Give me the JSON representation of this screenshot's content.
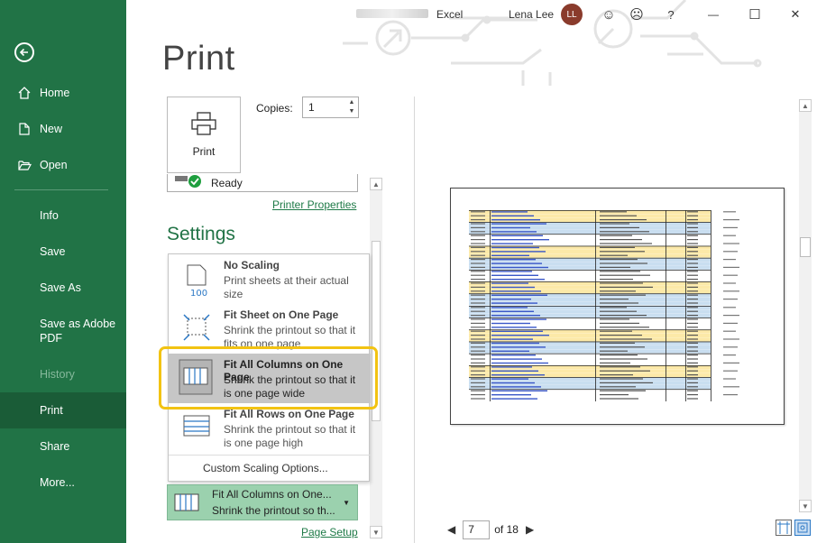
{
  "app": {
    "name": "Excel",
    "user_name": "Lena Lee",
    "user_initials": "LL"
  },
  "window_controls": {
    "smile": "☺",
    "frown": "☹",
    "help": "?",
    "minimize": "—",
    "maximize": "☐",
    "close": "✕"
  },
  "sidebar": {
    "items": [
      {
        "label": "Home",
        "icon": "home-icon"
      },
      {
        "label": "New",
        "icon": "new-file-icon"
      },
      {
        "label": "Open",
        "icon": "folder-open-icon"
      },
      {
        "label": "Info"
      },
      {
        "label": "Save"
      },
      {
        "label": "Save As"
      },
      {
        "label": "Save as Adobe PDF"
      },
      {
        "label": "History",
        "disabled": true
      },
      {
        "label": "Print",
        "active": true
      },
      {
        "label": "Share"
      },
      {
        "label": "More..."
      }
    ]
  },
  "print": {
    "title": "Print",
    "print_button": "Print",
    "copies_label": "Copies:",
    "copies_value": "1",
    "printer_status": "Ready",
    "printer_properties": "Printer Properties",
    "settings_title": "Settings",
    "page_setup": "Page Setup"
  },
  "scaling_menu": {
    "options": [
      {
        "title": "No Scaling",
        "desc": "Print sheets at their actual size",
        "icon_badge": "100"
      },
      {
        "title": "Fit Sheet on One Page",
        "desc": "Shrink the printout so that it fits on one page"
      },
      {
        "title": "Fit All Columns on One Page",
        "desc": "Shrink the printout so that it is one page wide",
        "highlighted": true
      },
      {
        "title": "Fit All Rows on One Page",
        "desc": "Shrink the printout so that it is one page high"
      }
    ],
    "custom": "Custom Scaling Options..."
  },
  "scaling_selected": {
    "line1": "Fit All Columns on One...",
    "line2": "Shrink the printout so th..."
  },
  "preview": {
    "current_page": "7",
    "of_label": "of 18"
  },
  "colors": {
    "accent": "#217346",
    "highlight_ring": "#f2c313",
    "selected_fill": "#9bd1ae"
  }
}
